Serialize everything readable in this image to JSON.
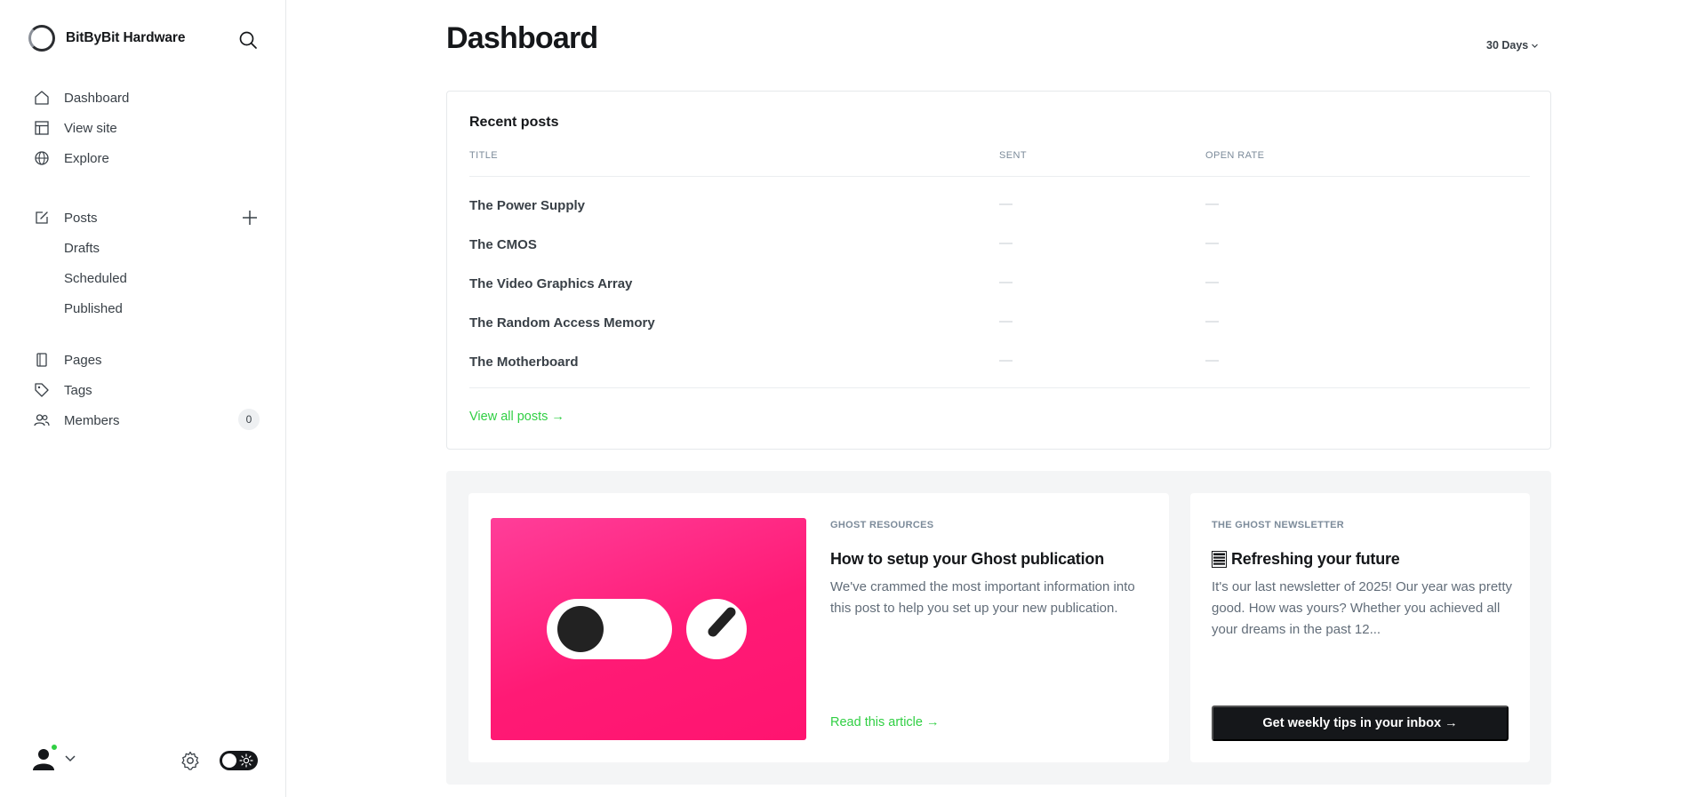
{
  "sidebar": {
    "brand": "BitByBit Hardware",
    "nav": [
      {
        "label": "Dashboard",
        "icon": "home-icon"
      },
      {
        "label": "View site",
        "icon": "layout-icon"
      },
      {
        "label": "Explore",
        "icon": "globe-icon"
      }
    ],
    "posts": {
      "label": "Posts",
      "icon": "edit-icon",
      "sub": [
        "Drafts",
        "Scheduled",
        "Published"
      ]
    },
    "other": [
      {
        "label": "Pages",
        "icon": "page-icon"
      },
      {
        "label": "Tags",
        "icon": "tag-icon"
      },
      {
        "label": "Members",
        "icon": "members-icon"
      }
    ],
    "members_count": "0"
  },
  "header": {
    "title": "Dashboard",
    "range": "30 Days"
  },
  "recent_posts": {
    "title": "Recent posts",
    "columns": [
      "TITLE",
      "SENT",
      "OPEN RATE"
    ],
    "rows": [
      {
        "title": "The Power Supply",
        "sent": "—",
        "open_rate": "—"
      },
      {
        "title": "The CMOS",
        "sent": "—",
        "open_rate": "—"
      },
      {
        "title": "The Video Graphics Array",
        "sent": "—",
        "open_rate": "—"
      },
      {
        "title": "The Random Access Memory",
        "sent": "—",
        "open_rate": "—"
      },
      {
        "title": "The Motherboard",
        "sent": "—",
        "open_rate": "—"
      }
    ],
    "view_all": "View all posts →"
  },
  "resources": {
    "eyebrow": "GHOST RESOURCES",
    "title": "How to setup your Ghost publication",
    "excerpt": "We've crammed the most important information into this post to help you set up your new publication.",
    "link": "Read this article →"
  },
  "newsletter": {
    "eyebrow": "THE GHOST NEWSLETTER",
    "title": "Refreshing your future",
    "title_icon": "newspaper-icon",
    "excerpt": "It's our last newsletter of 2025! Our year was pretty good. How was yours? Whether you achieved all your dreams in the past 12...",
    "cta": "Get weekly tips in your inbox →"
  },
  "colors": {
    "accent": "#30cf43",
    "text": "#15171a",
    "thumb": "#ff1a75"
  }
}
